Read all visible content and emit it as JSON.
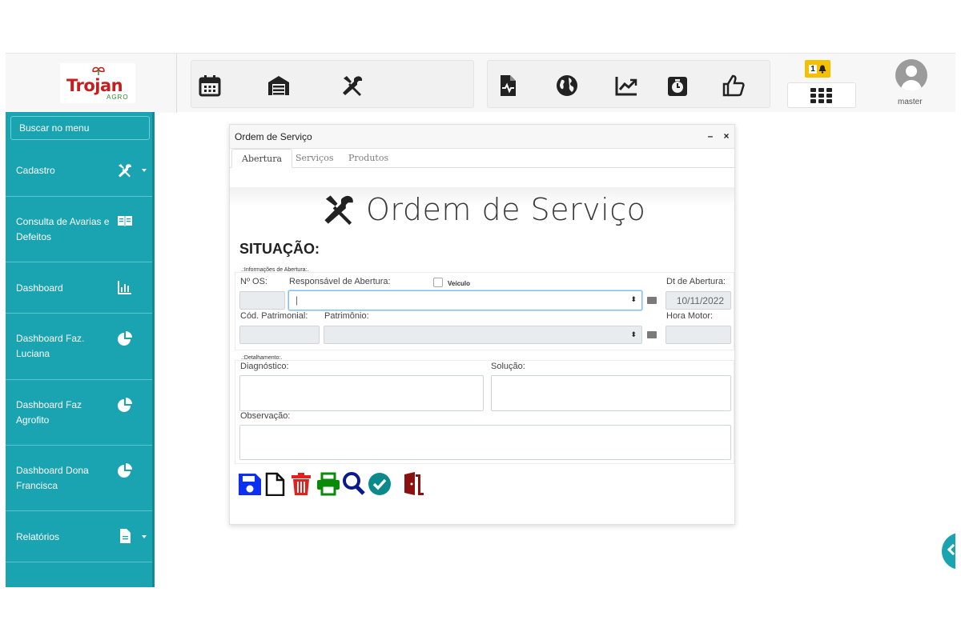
{
  "brand": {
    "name": "Trojan",
    "sub": "AGRO"
  },
  "toolbar": {
    "left_icons": [
      "calendar-icon",
      "warehouse-icon",
      "tools-icon"
    ],
    "right_icons": [
      "file-medical-icon",
      "globe-icon",
      "chart-line-icon",
      "stopwatch-icon",
      "thumbs-up-icon"
    ]
  },
  "notifications": {
    "count": "1"
  },
  "user": {
    "name": "master"
  },
  "sidebar": {
    "search_placeholder": "Buscar no menu",
    "items": [
      {
        "label": "Cadastro",
        "icon": "tools-icon",
        "has_caret": true
      },
      {
        "label": "Consulta de Avarias e Defeitos",
        "icon": "book-icon",
        "has_caret": false
      },
      {
        "label": "Dashboard",
        "icon": "bar-chart-icon",
        "has_caret": false
      },
      {
        "label": "Dashboard Faz. Luciana",
        "icon": "pie-chart-icon",
        "has_caret": false
      },
      {
        "label": "Dashboard Faz Agrofito",
        "icon": "pie-chart-icon",
        "has_caret": false
      },
      {
        "label": "Dashboard Dona Francisca",
        "icon": "pie-chart-icon",
        "has_caret": false
      },
      {
        "label": "Relatórios",
        "icon": "file-icon",
        "has_caret": true
      }
    ]
  },
  "dialog": {
    "title": "Ordem de Serviço",
    "minimize": "–",
    "close": "×",
    "tabs": [
      "Abertura",
      "Serviços",
      "Produtos"
    ],
    "banner_title": "Ordem de Serviço",
    "situacao": "SITUAÇÃO:",
    "sec_abertura": ".:Informações de Abertura:.",
    "sec_detalhamento": ".:Detalhamento:.",
    "labels": {
      "num_os": "Nº OS:",
      "responsavel": "Responsável de Abertura:",
      "veiculo": "Veículo",
      "dt_abertura": "Dt de Abertura:",
      "cod_patrimonial": "Cód. Patrimonial:",
      "patrimonio": "Patrimônio:",
      "hora_motor": "Hora Motor:",
      "diagnostico": "Diagnóstico:",
      "solucao": "Solução:",
      "observacao": "Observação:"
    },
    "values": {
      "num_os": "",
      "responsavel": "|",
      "dt_abertura": "10/11/2022",
      "cod_patrimonial": "",
      "patrimonio": "",
      "hora_motor": ""
    },
    "actions": [
      "save-icon",
      "new-file-icon",
      "delete-icon",
      "print-icon",
      "search-icon",
      "confirm-icon",
      "exit-icon"
    ]
  },
  "colors": {
    "sidebar": "#1aa3b1",
    "save": "#0d2ff0",
    "delete": "#e3201b",
    "print": "#0a8a0a",
    "search": "#0a1a8c",
    "confirm": "#0a8a8a",
    "exit": "#8b1010"
  }
}
